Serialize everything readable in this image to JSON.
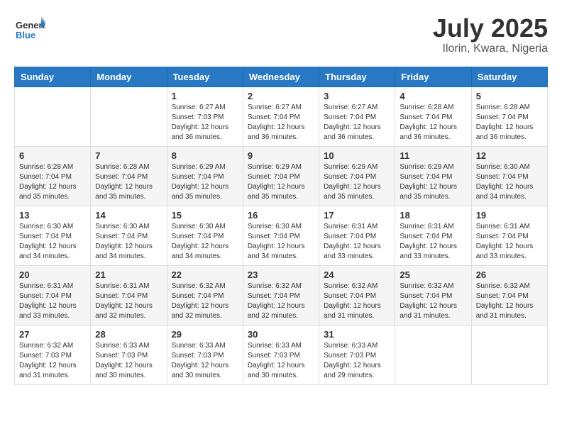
{
  "logo": {
    "text_general": "General",
    "text_blue": "Blue"
  },
  "title": "July 2025",
  "subtitle": "Ilorin, Kwara, Nigeria",
  "days_of_week": [
    "Sunday",
    "Monday",
    "Tuesday",
    "Wednesday",
    "Thursday",
    "Friday",
    "Saturday"
  ],
  "weeks": [
    [
      {
        "day": "",
        "info": ""
      },
      {
        "day": "",
        "info": ""
      },
      {
        "day": "1",
        "info": "Sunrise: 6:27 AM\nSunset: 7:03 PM\nDaylight: 12 hours and 36 minutes."
      },
      {
        "day": "2",
        "info": "Sunrise: 6:27 AM\nSunset: 7:04 PM\nDaylight: 12 hours and 36 minutes."
      },
      {
        "day": "3",
        "info": "Sunrise: 6:27 AM\nSunset: 7:04 PM\nDaylight: 12 hours and 36 minutes."
      },
      {
        "day": "4",
        "info": "Sunrise: 6:28 AM\nSunset: 7:04 PM\nDaylight: 12 hours and 36 minutes."
      },
      {
        "day": "5",
        "info": "Sunrise: 6:28 AM\nSunset: 7:04 PM\nDaylight: 12 hours and 36 minutes."
      }
    ],
    [
      {
        "day": "6",
        "info": "Sunrise: 6:28 AM\nSunset: 7:04 PM\nDaylight: 12 hours and 35 minutes."
      },
      {
        "day": "7",
        "info": "Sunrise: 6:28 AM\nSunset: 7:04 PM\nDaylight: 12 hours and 35 minutes."
      },
      {
        "day": "8",
        "info": "Sunrise: 6:29 AM\nSunset: 7:04 PM\nDaylight: 12 hours and 35 minutes."
      },
      {
        "day": "9",
        "info": "Sunrise: 6:29 AM\nSunset: 7:04 PM\nDaylight: 12 hours and 35 minutes."
      },
      {
        "day": "10",
        "info": "Sunrise: 6:29 AM\nSunset: 7:04 PM\nDaylight: 12 hours and 35 minutes."
      },
      {
        "day": "11",
        "info": "Sunrise: 6:29 AM\nSunset: 7:04 PM\nDaylight: 12 hours and 35 minutes."
      },
      {
        "day": "12",
        "info": "Sunrise: 6:30 AM\nSunset: 7:04 PM\nDaylight: 12 hours and 34 minutes."
      }
    ],
    [
      {
        "day": "13",
        "info": "Sunrise: 6:30 AM\nSunset: 7:04 PM\nDaylight: 12 hours and 34 minutes."
      },
      {
        "day": "14",
        "info": "Sunrise: 6:30 AM\nSunset: 7:04 PM\nDaylight: 12 hours and 34 minutes."
      },
      {
        "day": "15",
        "info": "Sunrise: 6:30 AM\nSunset: 7:04 PM\nDaylight: 12 hours and 34 minutes."
      },
      {
        "day": "16",
        "info": "Sunrise: 6:30 AM\nSunset: 7:04 PM\nDaylight: 12 hours and 34 minutes."
      },
      {
        "day": "17",
        "info": "Sunrise: 6:31 AM\nSunset: 7:04 PM\nDaylight: 12 hours and 33 minutes."
      },
      {
        "day": "18",
        "info": "Sunrise: 6:31 AM\nSunset: 7:04 PM\nDaylight: 12 hours and 33 minutes."
      },
      {
        "day": "19",
        "info": "Sunrise: 6:31 AM\nSunset: 7:04 PM\nDaylight: 12 hours and 33 minutes."
      }
    ],
    [
      {
        "day": "20",
        "info": "Sunrise: 6:31 AM\nSunset: 7:04 PM\nDaylight: 12 hours and 33 minutes."
      },
      {
        "day": "21",
        "info": "Sunrise: 6:31 AM\nSunset: 7:04 PM\nDaylight: 12 hours and 32 minutes."
      },
      {
        "day": "22",
        "info": "Sunrise: 6:32 AM\nSunset: 7:04 PM\nDaylight: 12 hours and 32 minutes."
      },
      {
        "day": "23",
        "info": "Sunrise: 6:32 AM\nSunset: 7:04 PM\nDaylight: 12 hours and 32 minutes."
      },
      {
        "day": "24",
        "info": "Sunrise: 6:32 AM\nSunset: 7:04 PM\nDaylight: 12 hours and 31 minutes."
      },
      {
        "day": "25",
        "info": "Sunrise: 6:32 AM\nSunset: 7:04 PM\nDaylight: 12 hours and 31 minutes."
      },
      {
        "day": "26",
        "info": "Sunrise: 6:32 AM\nSunset: 7:04 PM\nDaylight: 12 hours and 31 minutes."
      }
    ],
    [
      {
        "day": "27",
        "info": "Sunrise: 6:32 AM\nSunset: 7:03 PM\nDaylight: 12 hours and 31 minutes."
      },
      {
        "day": "28",
        "info": "Sunrise: 6:33 AM\nSunset: 7:03 PM\nDaylight: 12 hours and 30 minutes."
      },
      {
        "day": "29",
        "info": "Sunrise: 6:33 AM\nSunset: 7:03 PM\nDaylight: 12 hours and 30 minutes."
      },
      {
        "day": "30",
        "info": "Sunrise: 6:33 AM\nSunset: 7:03 PM\nDaylight: 12 hours and 30 minutes."
      },
      {
        "day": "31",
        "info": "Sunrise: 6:33 AM\nSunset: 7:03 PM\nDaylight: 12 hours and 29 minutes."
      },
      {
        "day": "",
        "info": ""
      },
      {
        "day": "",
        "info": ""
      }
    ]
  ]
}
